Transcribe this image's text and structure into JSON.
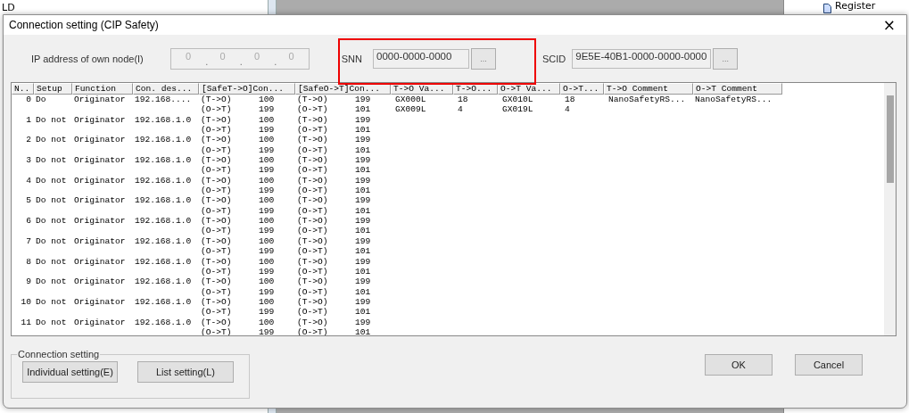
{
  "background": {
    "left_label": "LD",
    "tree_item": "Register"
  },
  "window": {
    "title": "Connection setting (CIP Safety)",
    "close": "×"
  },
  "own_node": {
    "label": "IP address of own node(I)",
    "octets": [
      "0",
      "0",
      "0",
      "0"
    ],
    "separator": "."
  },
  "snn": {
    "label": "SNN",
    "value": "0000-0000-0000",
    "button": "...",
    "highlighted": true
  },
  "scid": {
    "label": "SCID",
    "value": "9E5E-40B1-0000-0000-0000",
    "button": "..."
  },
  "table": {
    "columns": [
      "N..",
      "Setup",
      "Function",
      "Con. des...",
      "[SafeT->O]Con...",
      "[SafeO->T]Con...",
      "T->O Va...",
      "T->O...",
      "O->T Va...",
      "O->T...",
      "T->O Comment",
      "O->T Comment"
    ],
    "rows": [
      {
        "no": "0",
        "setup": "Do",
        "function": "Originator",
        "destination": "192.168....",
        "safe_t_o": [
          {
            "dir": "(T->O)",
            "value": "100"
          },
          {
            "dir": "(O->T)",
            "value": "199"
          }
        ],
        "safe_o_t": [
          {
            "dir": "(T->O)",
            "value": "199"
          },
          {
            "dir": "(O->T)",
            "value": "101"
          }
        ],
        "t_o_var": [
          "GX000L",
          "GX009L"
        ],
        "t_o_size": [
          "18",
          "4"
        ],
        "o_t_var": [
          "GX010L",
          "GX019L"
        ],
        "o_t_size": [
          "18",
          "4"
        ],
        "t_o_comment": "NanoSafetyRS...",
        "o_t_comment": "NanoSafetyRS..."
      },
      {
        "no": "1",
        "setup": "Do not",
        "function": "Originator",
        "destination": "192.168.1.0",
        "safe_t_o": [
          {
            "dir": "(T->O)",
            "value": "100"
          },
          {
            "dir": "(O->T)",
            "value": "199"
          }
        ],
        "safe_o_t": [
          {
            "dir": "(T->O)",
            "value": "199"
          },
          {
            "dir": "(O->T)",
            "value": "101"
          }
        ]
      },
      {
        "no": "2",
        "setup": "Do not",
        "function": "Originator",
        "destination": "192.168.1.0",
        "safe_t_o": [
          {
            "dir": "(T->O)",
            "value": "100"
          },
          {
            "dir": "(O->T)",
            "value": "199"
          }
        ],
        "safe_o_t": [
          {
            "dir": "(T->O)",
            "value": "199"
          },
          {
            "dir": "(O->T)",
            "value": "101"
          }
        ]
      },
      {
        "no": "3",
        "setup": "Do not",
        "function": "Originator",
        "destination": "192.168.1.0",
        "safe_t_o": [
          {
            "dir": "(T->O)",
            "value": "100"
          },
          {
            "dir": "(O->T)",
            "value": "199"
          }
        ],
        "safe_o_t": [
          {
            "dir": "(T->O)",
            "value": "199"
          },
          {
            "dir": "(O->T)",
            "value": "101"
          }
        ]
      },
      {
        "no": "4",
        "setup": "Do not",
        "function": "Originator",
        "destination": "192.168.1.0",
        "safe_t_o": [
          {
            "dir": "(T->O)",
            "value": "100"
          },
          {
            "dir": "(O->T)",
            "value": "199"
          }
        ],
        "safe_o_t": [
          {
            "dir": "(T->O)",
            "value": "199"
          },
          {
            "dir": "(O->T)",
            "value": "101"
          }
        ]
      },
      {
        "no": "5",
        "setup": "Do not",
        "function": "Originator",
        "destination": "192.168.1.0",
        "safe_t_o": [
          {
            "dir": "(T->O)",
            "value": "100"
          },
          {
            "dir": "(O->T)",
            "value": "199"
          }
        ],
        "safe_o_t": [
          {
            "dir": "(T->O)",
            "value": "199"
          },
          {
            "dir": "(O->T)",
            "value": "101"
          }
        ]
      },
      {
        "no": "6",
        "setup": "Do not",
        "function": "Originator",
        "destination": "192.168.1.0",
        "safe_t_o": [
          {
            "dir": "(T->O)",
            "value": "100"
          },
          {
            "dir": "(O->T)",
            "value": "199"
          }
        ],
        "safe_o_t": [
          {
            "dir": "(T->O)",
            "value": "199"
          },
          {
            "dir": "(O->T)",
            "value": "101"
          }
        ]
      },
      {
        "no": "7",
        "setup": "Do not",
        "function": "Originator",
        "destination": "192.168.1.0",
        "safe_t_o": [
          {
            "dir": "(T->O)",
            "value": "100"
          },
          {
            "dir": "(O->T)",
            "value": "199"
          }
        ],
        "safe_o_t": [
          {
            "dir": "(T->O)",
            "value": "199"
          },
          {
            "dir": "(O->T)",
            "value": "101"
          }
        ]
      },
      {
        "no": "8",
        "setup": "Do not",
        "function": "Originator",
        "destination": "192.168.1.0",
        "safe_t_o": [
          {
            "dir": "(T->O)",
            "value": "100"
          },
          {
            "dir": "(O->T)",
            "value": "199"
          }
        ],
        "safe_o_t": [
          {
            "dir": "(T->O)",
            "value": "199"
          },
          {
            "dir": "(O->T)",
            "value": "101"
          }
        ]
      },
      {
        "no": "9",
        "setup": "Do not",
        "function": "Originator",
        "destination": "192.168.1.0",
        "safe_t_o": [
          {
            "dir": "(T->O)",
            "value": "100"
          },
          {
            "dir": "(O->T)",
            "value": "199"
          }
        ],
        "safe_o_t": [
          {
            "dir": "(T->O)",
            "value": "199"
          },
          {
            "dir": "(O->T)",
            "value": "101"
          }
        ]
      },
      {
        "no": "10",
        "setup": "Do not",
        "function": "Originator",
        "destination": "192.168.1.0",
        "safe_t_o": [
          {
            "dir": "(T->O)",
            "value": "100"
          },
          {
            "dir": "(O->T)",
            "value": "199"
          }
        ],
        "safe_o_t": [
          {
            "dir": "(T->O)",
            "value": "199"
          },
          {
            "dir": "(O->T)",
            "value": "101"
          }
        ]
      },
      {
        "no": "11",
        "setup": "Do not",
        "function": "Originator",
        "destination": "192.168.1.0",
        "safe_t_o": [
          {
            "dir": "(T->O)",
            "value": "100"
          },
          {
            "dir": "(O->T)",
            "value": "199"
          }
        ],
        "safe_o_t": [
          {
            "dir": "(T->O)",
            "value": "199"
          },
          {
            "dir": "(O->T)",
            "value": "101"
          }
        ]
      }
    ]
  },
  "connection_group": {
    "label": "Connection setting",
    "buttons": [
      "Individual setting(E)",
      "List setting(L)"
    ]
  },
  "buttons": [
    "OK",
    "Cancel"
  ]
}
